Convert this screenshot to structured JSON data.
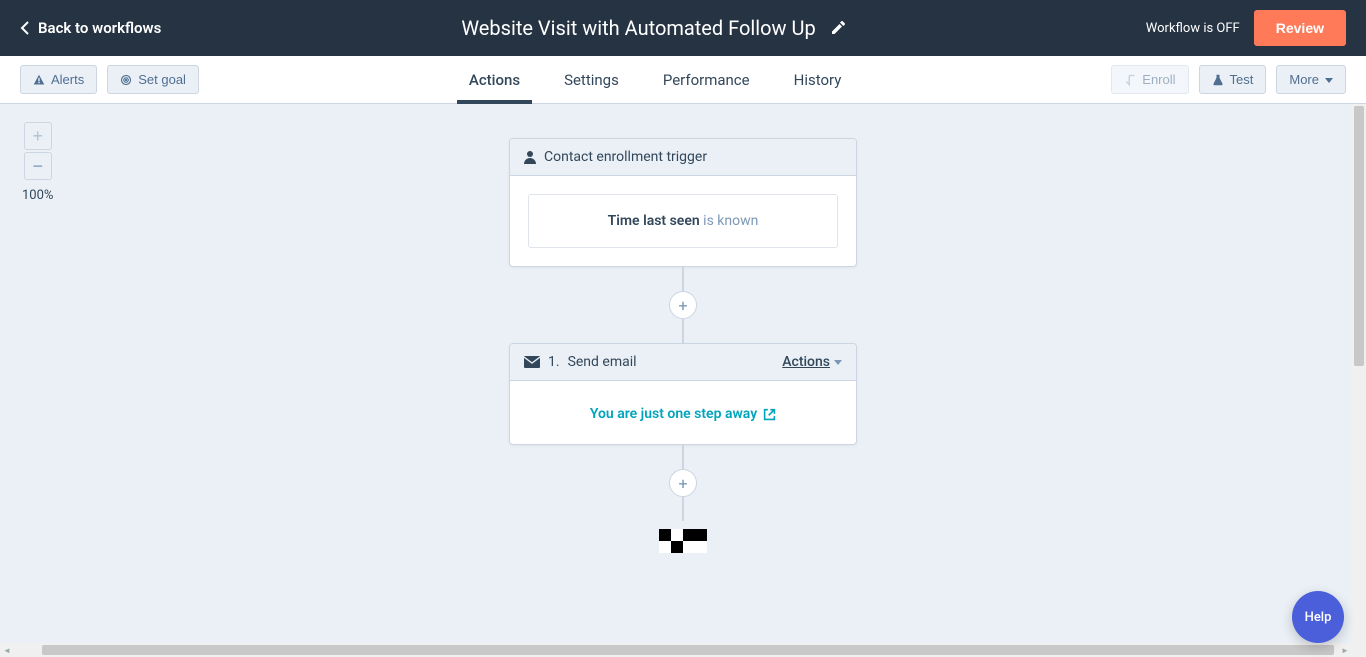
{
  "header": {
    "back_label": "Back to workflows",
    "title": "Website Visit with Automated Follow Up",
    "status": "Workflow is OFF",
    "review_label": "Review"
  },
  "toolbar": {
    "alerts_label": "Alerts",
    "set_goal_label": "Set goal",
    "enroll_label": "Enroll",
    "test_label": "Test",
    "more_label": "More"
  },
  "tabs": {
    "actions": "Actions",
    "settings": "Settings",
    "performance": "Performance",
    "history": "History"
  },
  "zoom": {
    "level": "100%"
  },
  "trigger": {
    "title": "Contact enrollment trigger",
    "condition_bold": "Time last seen",
    "condition_rest": " is known"
  },
  "step1": {
    "prefix": "1. ",
    "type": "Send email",
    "actions_label": "Actions",
    "link_text": "You are just one step away"
  },
  "help": {
    "label": "Help"
  }
}
